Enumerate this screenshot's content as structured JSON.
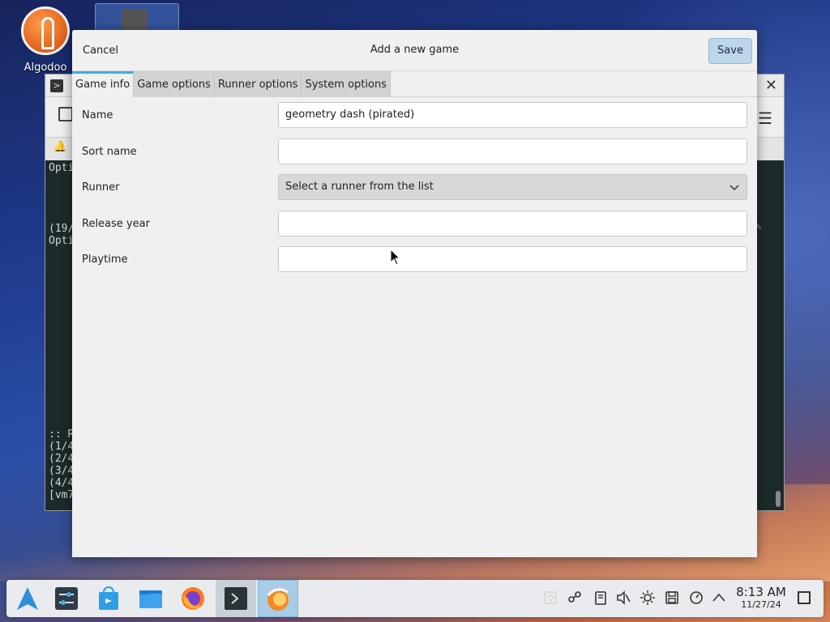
{
  "desktop": {
    "icons": [
      {
        "label": "Algodoo",
        "icon": "algodoo-icon"
      },
      {
        "label": "",
        "icon": "file-icon"
      }
    ]
  },
  "terminal": {
    "visible_lines": [
      "Opti",
      "(19/",
      "Opti",
      ":: R",
      "(1/4",
      "(2/4",
      "(3/4",
      "(4/4",
      "[vm7"
    ],
    "edge_text": "%"
  },
  "dialog": {
    "title": "Add a new game",
    "cancel_label": "Cancel",
    "save_label": "Save",
    "tabs": [
      {
        "label": "Game info",
        "active": true
      },
      {
        "label": "Game options",
        "active": false
      },
      {
        "label": "Runner options",
        "active": false
      },
      {
        "label": "System options",
        "active": false
      }
    ],
    "fields": {
      "name": {
        "label": "Name",
        "value": "geometry dash (pirated)"
      },
      "sort_name": {
        "label": "Sort name",
        "value": ""
      },
      "runner": {
        "label": "Runner",
        "value": "Select a runner from the list"
      },
      "release_year": {
        "label": "Release year",
        "value": ""
      },
      "playtime": {
        "label": "Playtime",
        "value": ""
      }
    }
  },
  "taskbar": {
    "apps": [
      "app-launcher-icon",
      "system-settings-icon",
      "discover-store-icon",
      "file-manager-icon",
      "firefox-icon",
      "terminal-icon",
      "lutris-icon"
    ],
    "tray": [
      "clipboard-icon",
      "network-icon",
      "storage-icon",
      "volume-muted-icon",
      "brightness-icon",
      "save-icon",
      "updates-icon",
      "tray-expand-icon"
    ],
    "time": "8:13 AM",
    "date": "11/27/24"
  },
  "colors": {
    "accent": "#3daee9",
    "save_button": "#bcd6ea",
    "dialog_bg": "#f0f0f0"
  }
}
